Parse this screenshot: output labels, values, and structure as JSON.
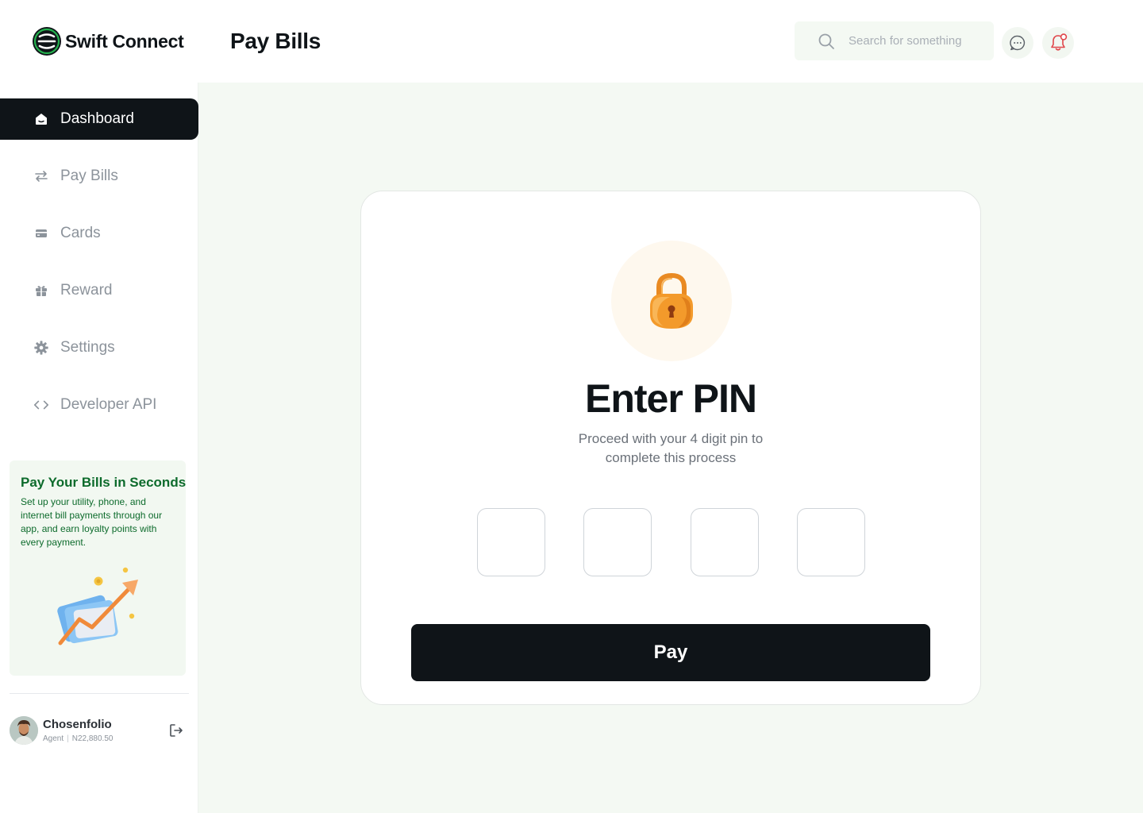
{
  "app": {
    "name": "Swift Connect"
  },
  "header": {
    "title": "Pay Bills",
    "search": {
      "placeholder": "Search for something",
      "value": ""
    },
    "icons": [
      "search-icon",
      "chat-icon",
      "bell-icon"
    ]
  },
  "sidebar": {
    "items": [
      {
        "label": "Dashboard",
        "icon": "home-icon",
        "active": true
      },
      {
        "label": "Pay Bills",
        "icon": "transfer-arrows-icon",
        "active": false
      },
      {
        "label": "Cards",
        "icon": "card-icon",
        "active": false
      },
      {
        "label": "Reward",
        "icon": "gift-icon",
        "active": false
      },
      {
        "label": "Settings",
        "icon": "gear-icon",
        "active": false
      },
      {
        "label": "Developer API",
        "icon": "code-icon",
        "active": false
      }
    ],
    "promo": {
      "title": "Pay Your Bills in Seconds",
      "text": "Set up your utility, phone, and internet bill payments through our app, and earn loyalty points with every payment."
    },
    "profile": {
      "name": "Chosenfolio",
      "role": "Agent",
      "balance": "N22,880.50"
    }
  },
  "pin_dialog": {
    "title": "Enter PIN",
    "subtitle": "Proceed with your 4 digit pin to complete this process",
    "digits": [
      "",
      "",
      "",
      ""
    ],
    "button_label": "Pay"
  },
  "colors": {
    "primary_dark": "#0f1418",
    "brand_green": "#0d6b2c",
    "background_tint": "#f4f9f3",
    "lock_orange": "#f39a2b",
    "notification_red": "#e0464a"
  }
}
